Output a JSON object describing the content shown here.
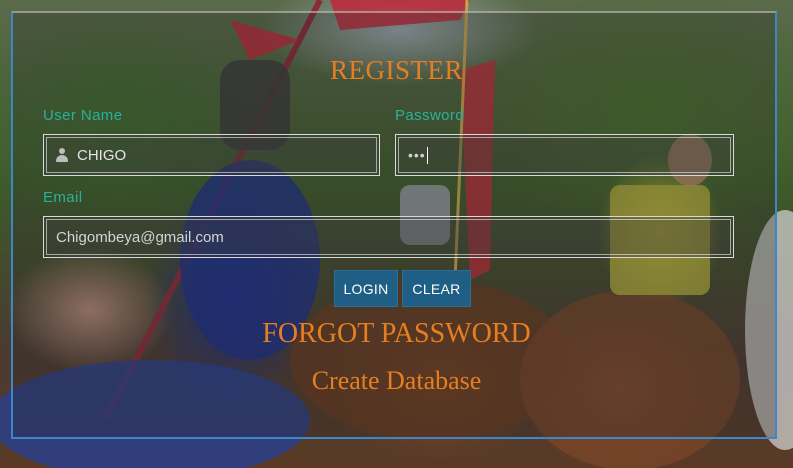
{
  "form": {
    "title": "REGISTER",
    "username_label": "User Name",
    "username_value": "CHIGO",
    "password_label": "Password",
    "password_mask": "•••",
    "email_label": "Email",
    "email_value": "Chigombeya@gmail.com"
  },
  "buttons": {
    "login": "LOGIN",
    "clear": "CLEAR"
  },
  "links": {
    "forgot_password": "FORGOT PASSWORD",
    "create_database": "Create Database"
  },
  "colors": {
    "accent_orange": "#e67e22",
    "label_teal": "#2ab09a",
    "button_blue": "#1f5f86",
    "panel_border": "#3e86c9"
  },
  "icons": {
    "username": "user-icon"
  }
}
